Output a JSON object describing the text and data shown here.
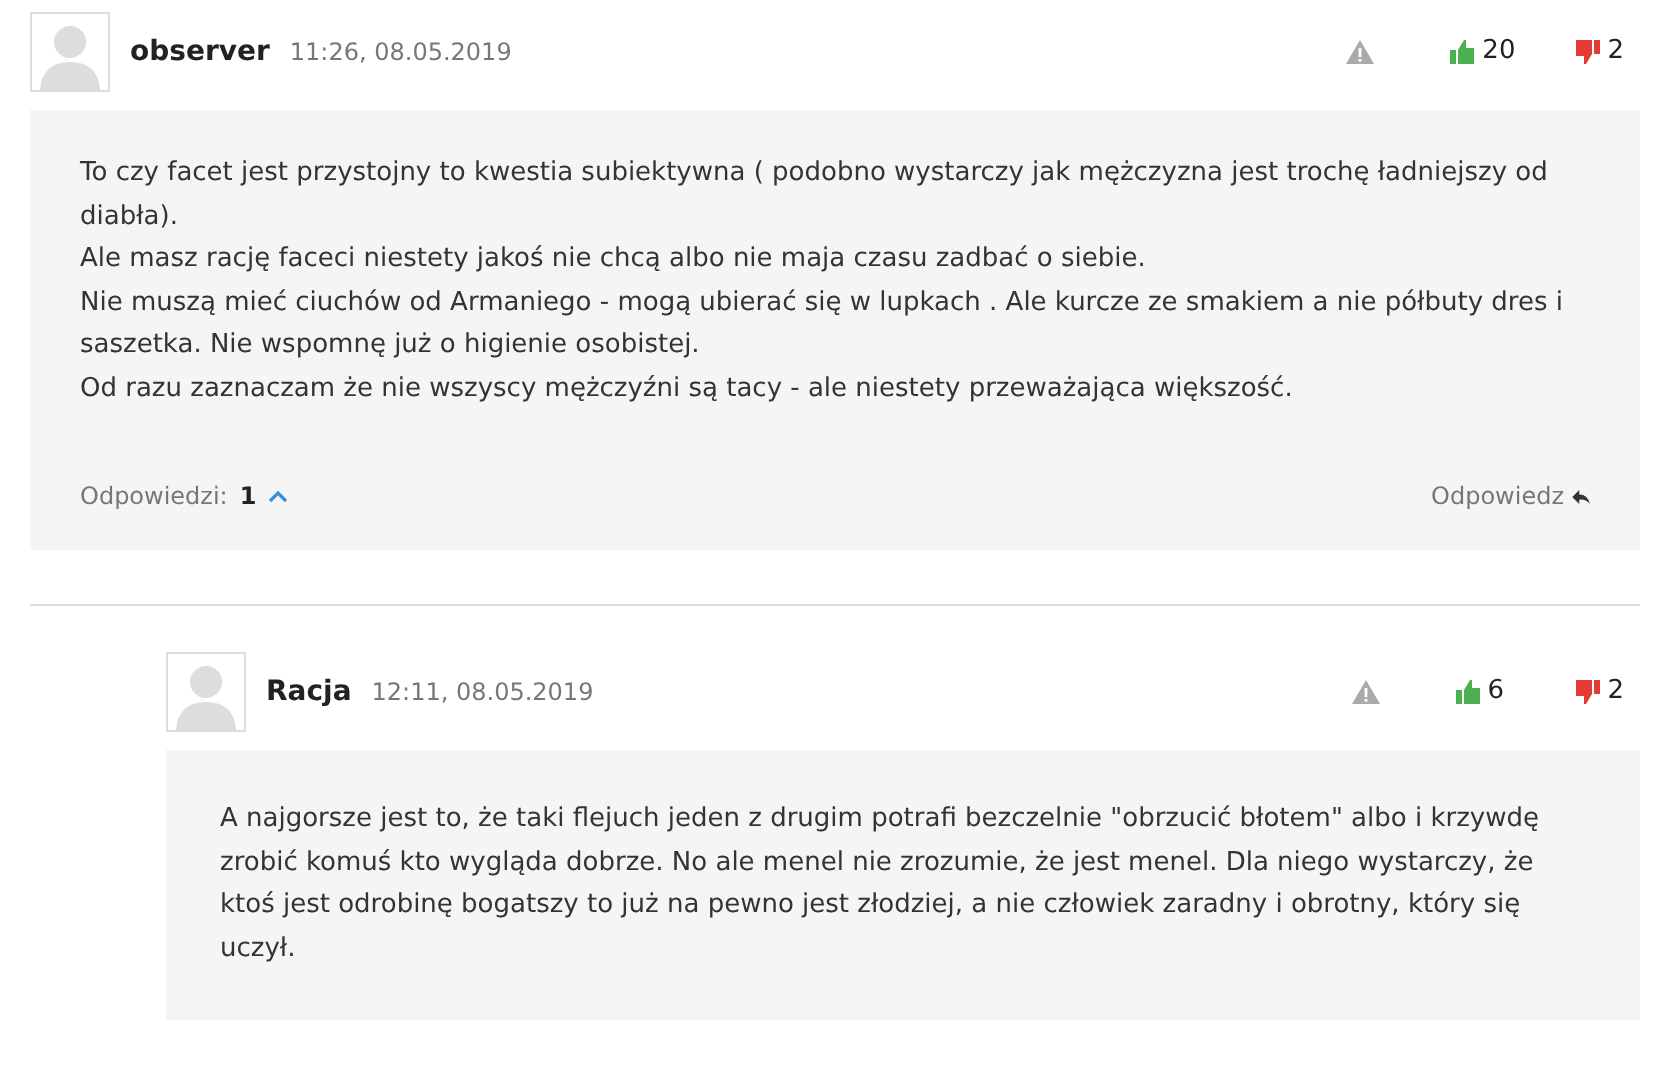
{
  "comments": [
    {
      "author": "observer",
      "time": "11:26, 08.05.2019",
      "up": "20",
      "down": "2",
      "text": "To czy facet jest przystojny to kwestia subiektywna ( podobno wystarczy jak mężczyzna jest trochę ładniejszy od diabła).\nAle masz rację faceci niestety jakoś nie chcą albo nie maja czasu zadbać o siebie.\nNie muszą mieć ciuchów od Armaniego - mogą ubierać się w lupkach . Ale kurcze ze smakiem a nie półbuty dres i saszetka. Nie wspomnę już o higienie osobistej.\nOd razu zaznaczam że nie wszyscy mężczyźni są tacy - ale niestety przeważająca większość.",
      "footer": {
        "replies_label": "Odpowiedzi:",
        "replies_count": "1",
        "expanded": true,
        "reply_link": "Odpowiedz"
      },
      "children": [
        {
          "author": "Racja",
          "time": "12:11, 08.05.2019",
          "up": "6",
          "down": "2",
          "text": "A najgorsze jest to, że taki flejuch jeden z drugim potrafi bezczelnie \"obrzucić błotem\" albo i krzywdę zrobić komuś kto wygląda dobrze. No ale menel nie zrozumie, że jest menel. Dla niego wystarczy, że ktoś jest odrobinę bogatszy to już na pewno jest złodziej, a nie człowiek zaradny i obrotny, który się uczył."
        }
      ]
    }
  ]
}
